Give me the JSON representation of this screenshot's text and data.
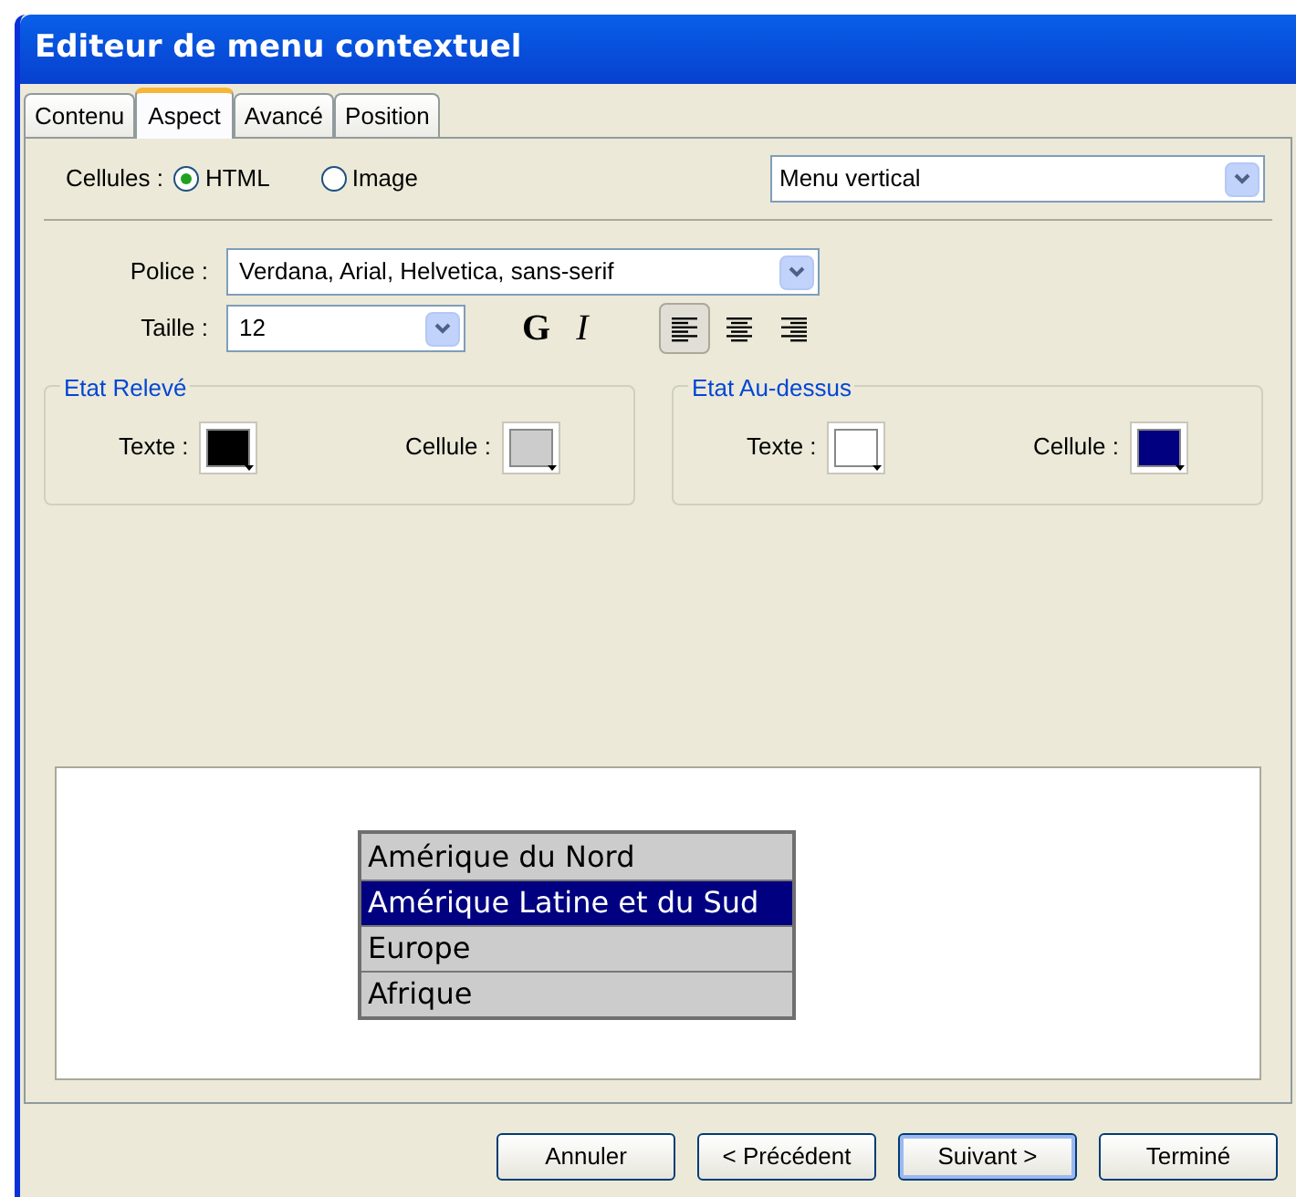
{
  "window": {
    "title": "Editeur de menu contextuel"
  },
  "tabs": [
    {
      "label": "Contenu",
      "selected": false
    },
    {
      "label": "Aspect",
      "selected": true
    },
    {
      "label": "Avancé",
      "selected": false
    },
    {
      "label": "Position",
      "selected": false
    }
  ],
  "cells": {
    "label": "Cellules :",
    "options": [
      {
        "label": "HTML",
        "selected": true
      },
      {
        "label": "Image",
        "selected": false
      }
    ]
  },
  "menu_type": {
    "value": "Menu vertical"
  },
  "font": {
    "label": "Police :",
    "value": "Verdana, Arial, Helvetica, sans-serif"
  },
  "size": {
    "label": "Taille :",
    "value": "12"
  },
  "style_buttons": [
    {
      "label": "G",
      "kind": "bold"
    },
    {
      "label": "I",
      "kind": "italic"
    }
  ],
  "align_buttons": [
    {
      "kind": "left",
      "selected": true
    },
    {
      "kind": "center",
      "selected": false
    },
    {
      "kind": "right",
      "selected": false
    }
  ],
  "groups": [
    {
      "title": "Etat Relevé",
      "swatches": [
        {
          "label": "Texte :",
          "color": "#000000"
        },
        {
          "label": "Cellule :",
          "color": "#cccccc"
        }
      ]
    },
    {
      "title": "Etat Au-dessus",
      "swatches": [
        {
          "label": "Texte :",
          "color": "#ffffff"
        },
        {
          "label": "Cellule :",
          "color": "#000080"
        }
      ]
    }
  ],
  "preview": {
    "items": [
      {
        "label": "Amérique du Nord",
        "selected": false
      },
      {
        "label": "Amérique Latine et du Sud",
        "selected": true
      },
      {
        "label": "Europe",
        "selected": false
      },
      {
        "label": "Afrique",
        "selected": false
      }
    ]
  },
  "buttons": [
    {
      "label": "Annuler",
      "default": false
    },
    {
      "label": "< Précédent",
      "default": false
    },
    {
      "label": "Suivant >",
      "default": true
    },
    {
      "label": "Terminé",
      "default": false
    }
  ]
}
